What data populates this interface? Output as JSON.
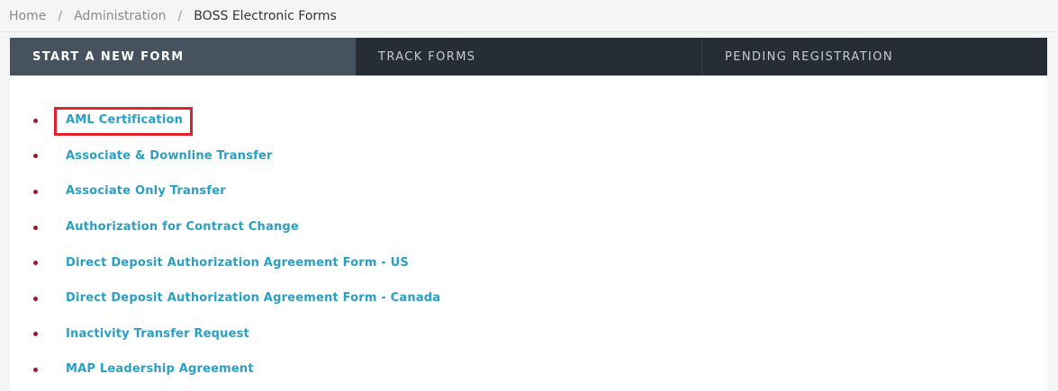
{
  "breadcrumb": {
    "items": [
      "Home",
      "Administration",
      "BOSS Electronic Forms"
    ],
    "separator": "/"
  },
  "tabs": [
    {
      "label": "START A NEW FORM",
      "active": true
    },
    {
      "label": "TRACK FORMS",
      "active": false
    },
    {
      "label": "PENDING REGISTRATION",
      "active": false
    }
  ],
  "forms": [
    {
      "label": "AML Certification",
      "highlighted": true
    },
    {
      "label": "Associate & Downline Transfer"
    },
    {
      "label": "Associate Only Transfer"
    },
    {
      "label": "Authorization for Contract Change"
    },
    {
      "label": "Direct Deposit Authorization Agreement Form - US"
    },
    {
      "label": "Direct Deposit Authorization Agreement Form - Canada"
    },
    {
      "label": "Inactivity Transfer Request"
    },
    {
      "label": "MAP Leadership Agreement"
    }
  ],
  "colors": {
    "tab_bar": "#262d35",
    "tab_active": "#46535f",
    "link": "#2a9fc5",
    "bullet": "#a0192c",
    "highlight": "#e0222d"
  }
}
